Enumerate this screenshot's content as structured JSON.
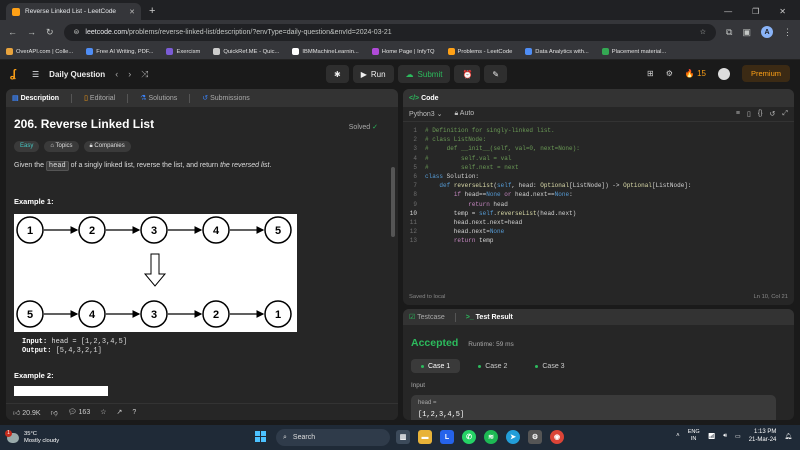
{
  "browser": {
    "tab_title": "Reverse Linked List - LeetCode",
    "url_domain": "leetcode.com",
    "url_path": "/problems/reverse-linked-list/description/?envType=daily-question&envId=2024-03-21",
    "profile_initial": "A",
    "bookmarks": [
      {
        "label": "OverAPI.com | Colle...",
        "color": "#e8a33d"
      },
      {
        "label": "Free AI Writing, PDF...",
        "color": "#4f8df5"
      },
      {
        "label": "Exercism",
        "color": "#7b5cd6"
      },
      {
        "label": "QuickRef.ME - Quic...",
        "color": "#cccccc"
      },
      {
        "label": "IBMMachineLearnin...",
        "color": "#ffffff"
      },
      {
        "label": "Home Page | InfyTQ",
        "color": "#b04bd8"
      },
      {
        "label": "Problems - LeetCode",
        "color": "#ffa116"
      },
      {
        "label": "Data Analytics with...",
        "color": "#4f8df5"
      },
      {
        "label": "Placement material...",
        "color": "#34a853"
      }
    ]
  },
  "nav": {
    "daily_question": "Daily Question",
    "run": "Run",
    "submit": "Submit",
    "streak": "15",
    "premium": "Premium"
  },
  "description": {
    "tabs": [
      "Description",
      "Editorial",
      "Solutions",
      "Submissions"
    ],
    "title": "206. Reverse Linked List",
    "solved": "Solved",
    "chips": {
      "easy": "Easy",
      "topics": "Topics",
      "companies": "Companies"
    },
    "statement_pre": "Given the ",
    "statement_code": "head",
    "statement_mid": " of a singly linked list, reverse the list, and return ",
    "statement_em": "the reversed list",
    "statement_end": ".",
    "example1": "Example 1:",
    "list_top": [
      "1",
      "2",
      "3",
      "4",
      "5"
    ],
    "list_bottom": [
      "5",
      "4",
      "3",
      "2",
      "1"
    ],
    "input_label": "Input:",
    "input_value": "head = [1,2,3,4,5]",
    "output_label": "Output:",
    "output_value": "[5,4,3,2,1]",
    "example2": "Example 2:",
    "likes": "20.9K",
    "comments": "163"
  },
  "code": {
    "header": "Code",
    "language": "Python3",
    "mode": "Auto",
    "lines": [
      "# Definition for singly-linked list.",
      "# class ListNode:",
      "#     def __init__(self, val=0, next=None):",
      "#         self.val = val",
      "#         self.next = next",
      "class Solution:",
      "    def reverseList(self, head: Optional[ListNode]) -> Optional[ListNode]:",
      "        if head==None or head.next==None:",
      "            return head",
      "        temp = self.reverseList(head.next)",
      "        head.next.next=head",
      "        head.next=None",
      "        return temp"
    ],
    "current_line": 10,
    "saved": "Saved to local",
    "cursor": "Ln 10, Col 21"
  },
  "test": {
    "tabs": [
      "Testcase",
      "Test Result"
    ],
    "status": "Accepted",
    "runtime": "Runtime: 59 ms",
    "cases": [
      "Case 1",
      "Case 2",
      "Case 3"
    ],
    "input_heading": "Input",
    "param": "head =",
    "value": "[1,2,3,4,5]"
  },
  "taskbar": {
    "temp": "35°C",
    "weather": "Mostly cloudy",
    "weather_badge": "1",
    "search": "Search",
    "time": "1:13 PM",
    "date": "21-Mar-24",
    "lang": "ENG",
    "region": "IN"
  }
}
